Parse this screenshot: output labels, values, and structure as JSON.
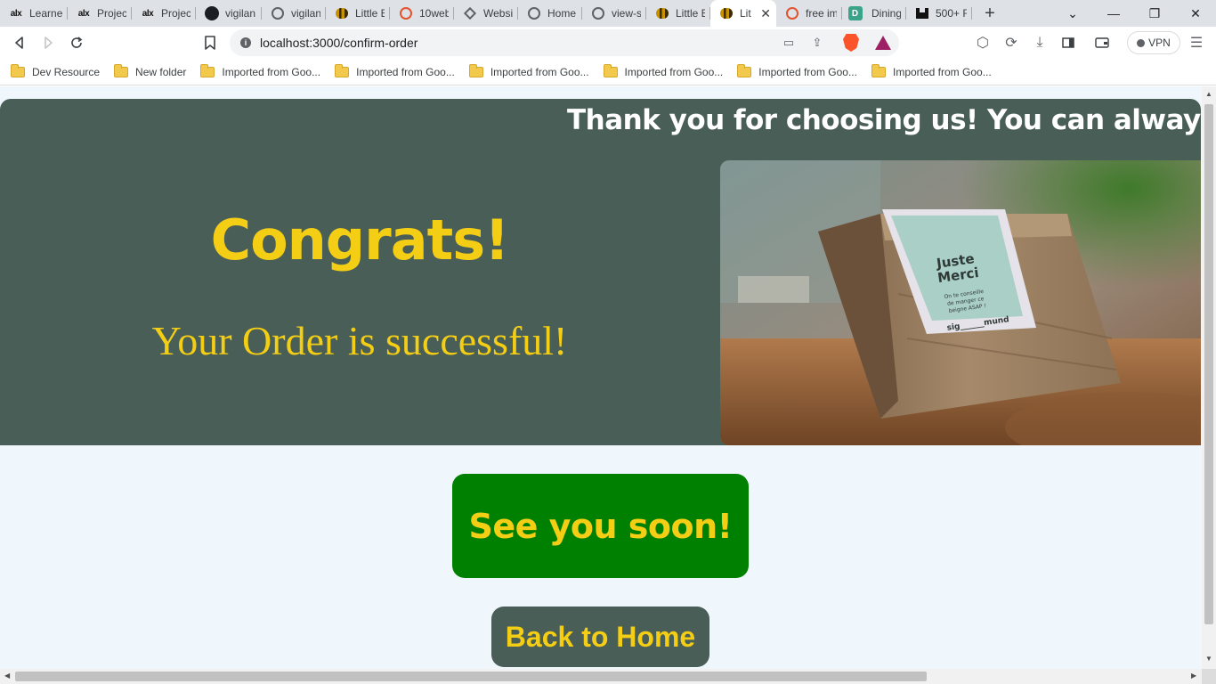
{
  "tabs": [
    {
      "title": "Learne",
      "icon": "alx-icon"
    },
    {
      "title": "Project",
      "icon": "alx-icon"
    },
    {
      "title": "Project",
      "icon": "alx-icon"
    },
    {
      "title": "vigilan",
      "icon": "github-icon"
    },
    {
      "title": "vigilan",
      "icon": "globe-icon"
    },
    {
      "title": "Little B",
      "icon": "bee-icon"
    },
    {
      "title": "10web",
      "icon": "brave-icon"
    },
    {
      "title": "Websit",
      "icon": "diamond-icon"
    },
    {
      "title": "Home",
      "icon": "globe-icon"
    },
    {
      "title": "view-s",
      "icon": "globe-icon"
    },
    {
      "title": "Little B",
      "icon": "bee-icon"
    },
    {
      "title": "Lit",
      "icon": "bee-icon",
      "active": true
    },
    {
      "title": "free im",
      "icon": "brave-icon"
    },
    {
      "title": "Dining",
      "icon": "d-icon"
    },
    {
      "title": "500+ F",
      "icon": "unsplash-icon"
    }
  ],
  "address_bar": {
    "url": "localhost:3000/confirm-order"
  },
  "vpn_label": "VPN",
  "bookmarks": [
    "Dev Resource",
    "New folder",
    "Imported from Goo...",
    "Imported from Goo...",
    "Imported from Goo...",
    "Imported from Goo...",
    "Imported from Goo...",
    "Imported from Goo..."
  ],
  "page": {
    "marquee": "Thank you for choosing us! You can always cou",
    "heading": "Congrats!",
    "subheading": "Your Order is successful!",
    "image": {
      "label_line1": "Juste",
      "label_line2": "Merci",
      "label_small1": "On te conseille",
      "label_small2": "de manger ce",
      "label_small3": "beigne ASAP !",
      "signature": "sig______mund"
    },
    "see_you_button": "See you soon!",
    "home_button": "Back to Home"
  },
  "colors": {
    "primary_green": "#495e57",
    "accent_yellow": "#f4ce14",
    "button_green": "#008000",
    "page_bg": "#f0f7fc"
  }
}
